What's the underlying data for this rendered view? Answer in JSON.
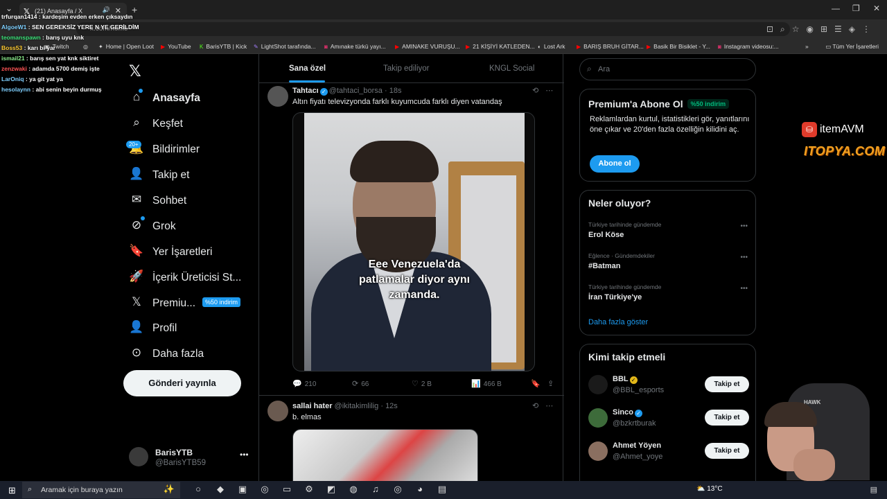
{
  "browser": {
    "tab_title": "(21) Anasayfa / X",
    "new_tab": "+",
    "url": "x.com/home",
    "bookmarks": [
      {
        "label": "Twitch",
        "icon": "twitch-icon"
      },
      {
        "label": "Home | Open Loot",
        "icon": "open-loot-icon"
      },
      {
        "label": "YouTube",
        "icon": "youtube-icon"
      },
      {
        "label": "BarisYTB | Kick",
        "icon": "kick-icon"
      },
      {
        "label": "LightShot tarafında...",
        "icon": "lightshot-icon"
      },
      {
        "label": "Amınake türkü yayı...",
        "icon": "instagram-icon"
      },
      {
        "label": "AMINAKE VURUŞU...",
        "icon": "youtube-icon"
      },
      {
        "label": "21 KİŞİYİ KATLEDEN...",
        "icon": "youtube-icon"
      },
      {
        "label": "Lost Ark",
        "icon": "lost-ark-icon"
      },
      {
        "label": "BARIŞ BRUH GİTAR...",
        "icon": "youtube-icon"
      },
      {
        "label": "Basik Bir Bisiklet - Y...",
        "icon": "youtube-icon"
      },
      {
        "label": "Instagram videosu:...",
        "icon": "instagram-icon"
      }
    ],
    "all_bookmarks": "Tüm Yer İşaretleri"
  },
  "chat": [
    {
      "user": "trfurqan1414",
      "msg": "kardeşim evden erken çıksaydın",
      "color": "#ffffff"
    },
    {
      "user": "AlgoeW1",
      "msg": "SEN GEREKSİZ YERE N YE GERİLDİM",
      "color": "#7fd0ff"
    },
    {
      "user": "teomanspawn",
      "msg": "barış uyu knk",
      "color": "#3ee07a"
    },
    {
      "user": "Boss53",
      "msg": "karı bi yar",
      "color": "#ffcc33"
    },
    {
      "user": "ismail21",
      "msg": "barış sen yat knk siktiret",
      "color": "#8ef08e"
    },
    {
      "user": "zenzwaki",
      "msg": "adamda 5700 demiş işte",
      "color": "#ff5555"
    },
    {
      "user": "LarOniq",
      "msg": "ya git yat ya",
      "color": "#7fd0ff"
    },
    {
      "user": "hesolaynn",
      "msg": "abi senin beyin durmuş",
      "color": "#7fd0ff"
    }
  ],
  "nav": {
    "items": [
      {
        "label": "Anasayfa",
        "icon": "home-icon"
      },
      {
        "label": "Keşfet",
        "icon": "search-icon"
      },
      {
        "label": "Bildirimler",
        "icon": "bell-icon"
      },
      {
        "label": "Takip et",
        "icon": "follow-icon"
      },
      {
        "label": "Sohbet",
        "icon": "mail-icon"
      },
      {
        "label": "Grok",
        "icon": "grok-icon"
      },
      {
        "label": "Yer İşaretleri",
        "icon": "bookmark-icon"
      },
      {
        "label": "İçerik Üreticisi St...",
        "icon": "rocket-icon"
      },
      {
        "label": "Premiu...",
        "icon": "x-premium-icon"
      },
      {
        "label": "Profil",
        "icon": "profile-icon"
      },
      {
        "label": "Daha fazla",
        "icon": "more-circle-icon"
      }
    ],
    "notif_count": "20+",
    "premium_badge": "%50 indirim",
    "post_button": "Gönderi yayınla",
    "profile": {
      "name": "BarisYTB",
      "handle": "@BarisYTB59"
    }
  },
  "timeline": {
    "tabs": [
      "Sana özel",
      "Takip ediliyor",
      "KNGL Social"
    ],
    "tweets": [
      {
        "name": "Tahtacı",
        "handle": "@tahtaci_borsa",
        "time": "18s",
        "text": "Altın fiyatı televizyonda farklı kuyumcuda farklı diyen vatandaş",
        "caption_lines": [
          "Eee Venezuela'da",
          "patlamalar diyor aynı",
          "zamanda."
        ],
        "replies": "210",
        "reposts": "66",
        "likes": "2 B",
        "views": "466 B"
      },
      {
        "name": "sallai hater",
        "handle": "@ikitakimlilig",
        "time": "12s",
        "text": "b. elmas"
      }
    ]
  },
  "right": {
    "search_placeholder": "Ara",
    "premium": {
      "title": "Premium'a Abone Ol",
      "badge": "%50 indirim",
      "desc": "Reklamlardan kurtul, istatistikleri gör, yanıtlarını öne çıkar ve 20'den fazla özelliğin kilidini aç.",
      "button": "Abone ol"
    },
    "trends": {
      "title": "Neler oluyor?",
      "items": [
        {
          "context": "Türkiye tarihinde gündemde",
          "topic": "Erol Köse"
        },
        {
          "context": "Eğlence · Gündemdekiler",
          "topic": "#Batman"
        },
        {
          "context": "Türkiye tarihinde gündemde",
          "topic": "İran Türkiye'ye"
        }
      ],
      "show_more": "Daha fazla göster"
    },
    "who_to_follow": {
      "title": "Kimi takip etmeli",
      "items": [
        {
          "name": "BBL",
          "handle": "@BBL_esports",
          "badge": "gold",
          "button": "Takip et"
        },
        {
          "name": "Sinco",
          "handle": "@bzkrtburak",
          "badge": "blue",
          "button": "Takip et"
        },
        {
          "name": "Ahmet Yöyen",
          "handle": "@Ahmet_yoye",
          "badge": "",
          "button": "Takip et"
        }
      ]
    }
  },
  "sponsor": {
    "line1": "itemAVM",
    "line2": "ITOPYA.COM",
    "chair_logo": "HAWK"
  },
  "taskbar": {
    "search_placeholder": "Aramak için buraya yazın",
    "temperature": "13°C"
  },
  "colors": {
    "accent": "#1d9bf0",
    "background": "#000000",
    "muted": "#71767b",
    "success": "#00ba7c"
  }
}
